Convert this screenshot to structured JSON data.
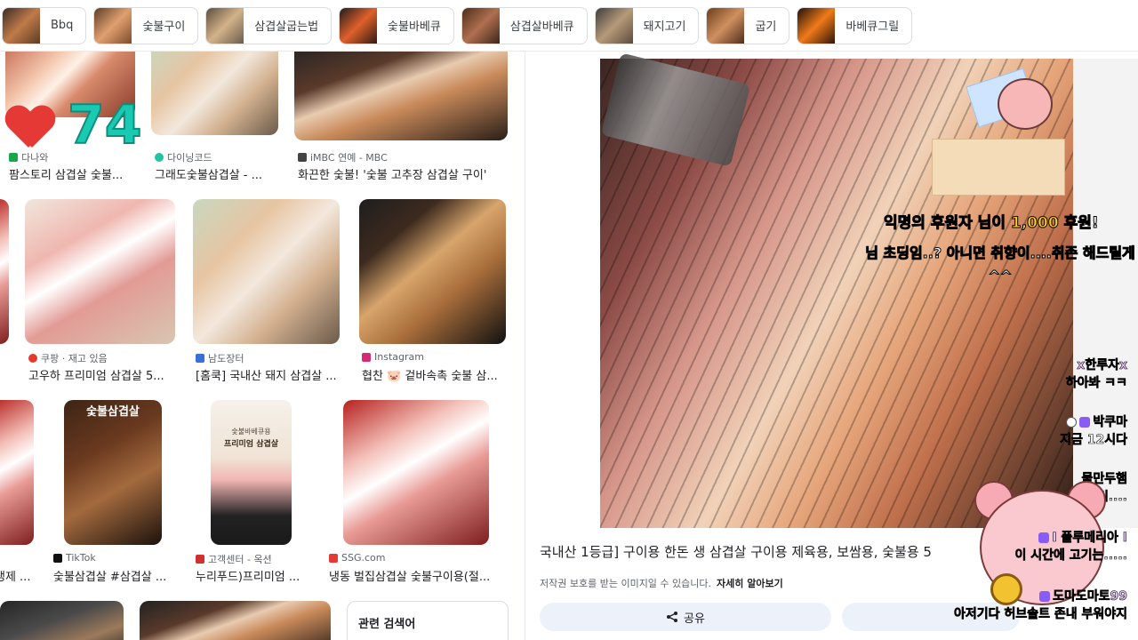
{
  "chips": [
    {
      "label": "Bbq",
      "color": "#7a4a2a"
    },
    {
      "label": "숯불구이",
      "color": "#a25a34"
    },
    {
      "label": "삼겹살굽는법",
      "color": "#8a6a4a"
    },
    {
      "label": "숯불바베큐",
      "color": "#c0502a"
    },
    {
      "label": "삼겹살바베큐",
      "color": "#6a3a22"
    },
    {
      "label": "돼지고기",
      "color": "#9a7a5a"
    },
    {
      "label": "굽기",
      "color": "#b06a3a"
    },
    {
      "label": "바베큐그릴",
      "color": "#d0602a"
    }
  ],
  "results": [
    {
      "source": "다나와",
      "title": "팜스토리 삼겹살 숯불...",
      "fav": "#19a64b"
    },
    {
      "source": "다이닝코드",
      "title": "그래도숯불삼겹살 - ...",
      "fav": "#23c4a6"
    },
    {
      "source": "iMBC 연예 - MBC",
      "title": "화끈한 숯불! '숯불 고추장 삼겹살 구이'",
      "fav": "#444444"
    },
    {
      "source": "쿠팡 · 재고 있음",
      "title": "고우하 프리미엄 삼겹살 5...",
      "fav": "#e23b2e"
    },
    {
      "source": "남도장터",
      "title": "[홈쿡] 국내산 돼지 삼겹살 ...",
      "fav": "#3a6fd8"
    },
    {
      "source": "Instagram",
      "title": "협찬 🐷 겉바속촉 숯불 삼...",
      "fav": "#d62976"
    },
    {
      "source": "TikTok",
      "title": "숯불삼겹살 #삼겹살 ...",
      "fav": "#111111"
    },
    {
      "source": "고객센터 - 옥션",
      "title": "누리푸드)프리미엄 ...",
      "fav": "#d32f2f"
    },
    {
      "source": "SSG.com",
      "title": "냉동 벌집삼겹살 숯불구이용(절...",
      "fav": "#e53935"
    },
    {
      "source": "",
      "title": "냉제 ...",
      "fav": "#ffffff"
    }
  ],
  "thumb_labels": {
    "sumbul": "숯불삼겹살",
    "premium_box_top": "숯불바베큐용",
    "premium_box": "프리미엄 삼겹살"
  },
  "related_search": "관련 검색어",
  "overlay": {
    "like_count": "74"
  },
  "preview": {
    "title": "국내산 1등급] 구이용 한돈 생 삼겹살 구이용 제육용, 보쌈용, 숯불용 5",
    "copyright": "저작권 보호를 받는 이미지일 수 있습니다.",
    "learn_more": "자세히 알아보기",
    "share": "공유"
  },
  "donation": {
    "donor": "익명의 후원자",
    "suffix1": " 님이 ",
    "amount": "1,000",
    "suffix2": " 후원!",
    "message": "님 초딩임..? 아니면 취향이....취존 해드릴게^^"
  },
  "chat": [
    {
      "nick": "x한루자x",
      "msg": "하아봐 ㅋㅋ"
    },
    {
      "nick": "박쿠마",
      "msg": "지금 12시다"
    },
    {
      "nick": "물만두햄",
      "msg": "와씨...."
    },
    {
      "nick": "I 플루메리아 I",
      "msg": "이 시간에 고기는....."
    },
    {
      "nick": "도마도마토99",
      "msg": "아저기다 허브솔트 존내 부워야지"
    }
  ]
}
